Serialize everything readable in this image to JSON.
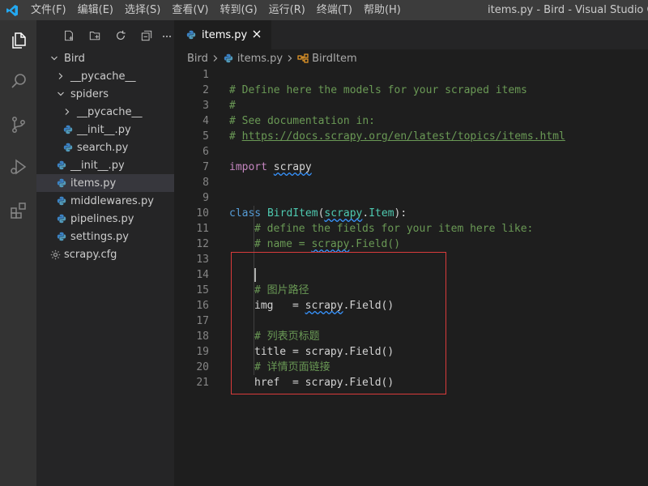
{
  "menu": [
    "文件(F)",
    "编辑(E)",
    "选择(S)",
    "查看(V)",
    "转到(G)",
    "运行(R)",
    "终端(T)",
    "帮助(H)"
  ],
  "window_title": "items.py - Bird - Visual Studio Code [管",
  "explorer": {
    "items": [
      {
        "label": "Bird",
        "type": "folder-open"
      },
      {
        "label": "__pycache__",
        "type": "folder"
      },
      {
        "label": "spiders",
        "type": "folder-open"
      },
      {
        "label": "__pycache__",
        "type": "folder"
      },
      {
        "label": "__init__.py",
        "type": "py"
      },
      {
        "label": "search.py",
        "type": "py"
      },
      {
        "label": "__init__.py",
        "type": "py"
      },
      {
        "label": "items.py",
        "type": "py"
      },
      {
        "label": "middlewares.py",
        "type": "py"
      },
      {
        "label": "pipelines.py",
        "type": "py"
      },
      {
        "label": "settings.py",
        "type": "py"
      },
      {
        "label": "scrapy.cfg",
        "type": "cfg"
      }
    ]
  },
  "tab": {
    "label": "items.py"
  },
  "breadcrumb": {
    "folder": "Bird",
    "file": "items.py",
    "symbol": "BirdItem"
  },
  "code": {
    "l1": "# Define here the models for your scraped items",
    "l2": "#",
    "l3": "# See documentation in:",
    "l4_prefix": "# ",
    "l4_link": "https://docs.scrapy.org/en/latest/topics/items.html",
    "l6_kw": "import",
    "l6_mod": "scrapy",
    "l9_kw": "class",
    "l9_name": "BirdItem",
    "l9_open": "(",
    "l9_base_mod": "scrapy",
    "l9_base_dot": ".",
    "l9_base_cls": "Item",
    "l9_close": "):",
    "l10": "# define the fields for your item here like:",
    "l11_a": "# name = ",
    "l11_b": "scrapy",
    "l11_c": ".Field()",
    "l14": "# 图片路径",
    "l15_a": "img   = ",
    "l15_b": "scrapy",
    "l15_c": ".Field()",
    "l17": "# 列表页标题",
    "l18": "title = scrapy.Field()",
    "l19": "# 详情页面链接",
    "l20": "href  = scrapy.Field()"
  },
  "line_numbers": [
    "1",
    "2",
    "3",
    "4",
    "5",
    "6",
    "7",
    "8",
    "9",
    "10",
    "11",
    "12",
    "13",
    "14",
    "15",
    "16",
    "17",
    "18",
    "19",
    "20",
    "21"
  ],
  "colors": {
    "highlight_box": "#d93b3b",
    "accent": "#007acc"
  }
}
